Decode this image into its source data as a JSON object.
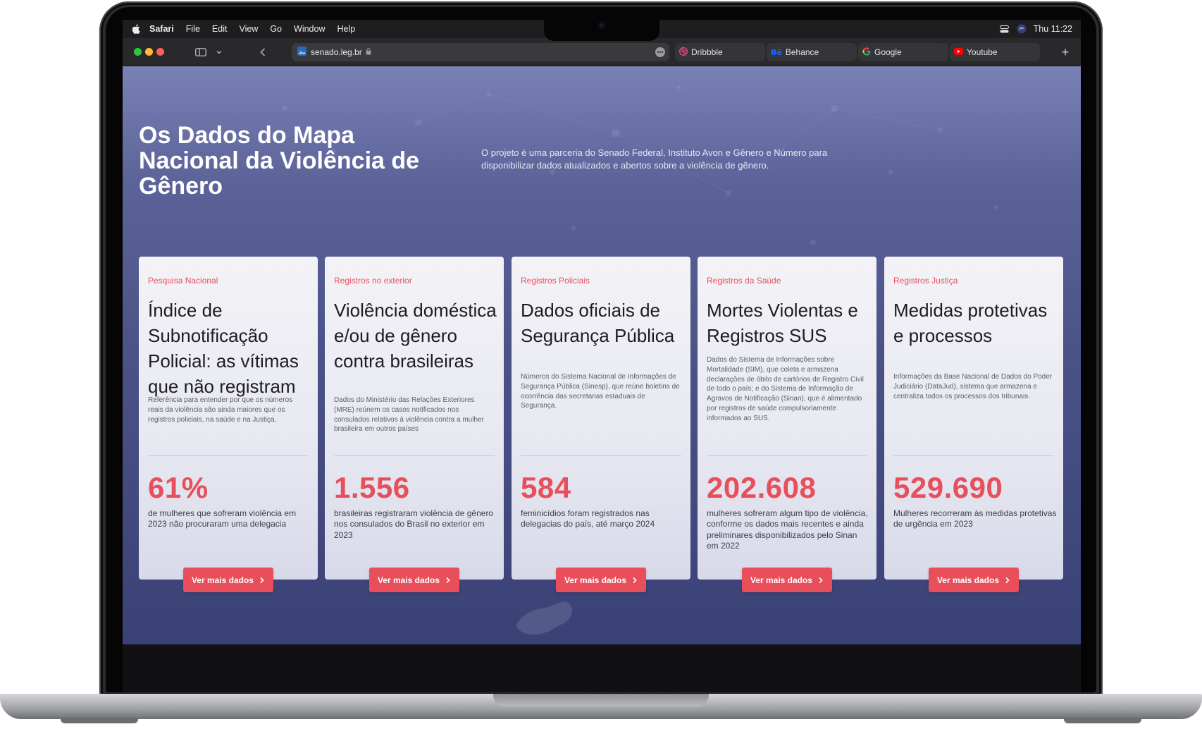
{
  "menubar": {
    "app_name": "Safari",
    "items": [
      "File",
      "Edit",
      "View",
      "Go",
      "Window",
      "Help"
    ],
    "clock": "Thu 11:22"
  },
  "browser": {
    "address": "senado.leg.br",
    "tabs": [
      {
        "label": "Dribbble",
        "icon": "dribbble-icon",
        "color": "#ea4c89"
      },
      {
        "label": "Behance",
        "icon": "behance-icon",
        "color": "#1769ff"
      },
      {
        "label": "Google",
        "icon": "google-icon",
        "color": "#4285f4"
      },
      {
        "label": "Youtube",
        "icon": "youtube-icon",
        "color": "#ff0000"
      }
    ]
  },
  "hero": {
    "title": "Os Dados do Mapa Nacional da Violência de Gênero",
    "description": "O projeto é uma parceria do Senado Federal, Instituto Avon e Gênero e Número para disponibilizar dados atualizados e abertos sobre a violência de gênero."
  },
  "cards": [
    {
      "category": "Pesquisa Nacional",
      "title": "Índice de Subnotificação Policial: as vítimas que não registram",
      "description": "Referência para entender por que os números reais da violência são ainda maiores que os registros policiais, na saúde e na Justiça.",
      "stat": "61%",
      "stat_text": "de mulheres que sofreram violência em 2023 não procuraram uma delegacia",
      "button": "Ver mais dados"
    },
    {
      "category": "Registros no exterior",
      "title": "Violência doméstica e/ou de gênero contra brasileiras",
      "description": "Dados do Ministério das Relações Exteriores (MRE) reúnem os casos notificados nos consulados relativos à violência contra a mulher brasileira em outros países",
      "stat": "1.556",
      "stat_text": "brasileiras registraram violência de gênero nos consulados do Brasil no exterior em 2023",
      "button": "Ver mais dados"
    },
    {
      "category": "Registros Policiais",
      "title": "Dados oficiais de Segurança Pública",
      "description": "Números do Sistema Nacional de Informações de Segurança Pública (Sinesp), que reúne boletins de ocorrência das secretarias estaduais de Segurança.",
      "stat": "584",
      "stat_text": "feminicídios foram registrados nas delegacias do país, até março 2024",
      "button": "Ver mais dados"
    },
    {
      "category": "Registros da Saúde",
      "title": "Mortes Violentas e Registros SUS",
      "description": "Dados do Sistema de Informações sobre Mortalidade (SIM), que coleta e armazena declarações de óbito de cartórios de Registro Civil de todo o país; e do Sistema de Informação de Agravos de Notificação (Sinan), que é alimentado por registros de saúde compulsoriamente informados ao SUS.",
      "stat": "202.608",
      "stat_text": "mulheres sofreram algum tipo de violência, conforme os dados mais recentes e ainda preliminares disponibilizados pelo Sinan em 2022",
      "button": "Ver mais dados"
    },
    {
      "category": "Registros Justiça",
      "title": "Medidas protetivas e processos",
      "description": "Informações da Base Nacional de Dados do Poder Judiciário (DataJud), sistema que armazena e centraliza todos os processos dos tribunais.",
      "stat": "529.690",
      "stat_text": "Mulheres recorreram às medidas protetivas de urgência em 2023",
      "button": "Ver mais dados"
    }
  ]
}
